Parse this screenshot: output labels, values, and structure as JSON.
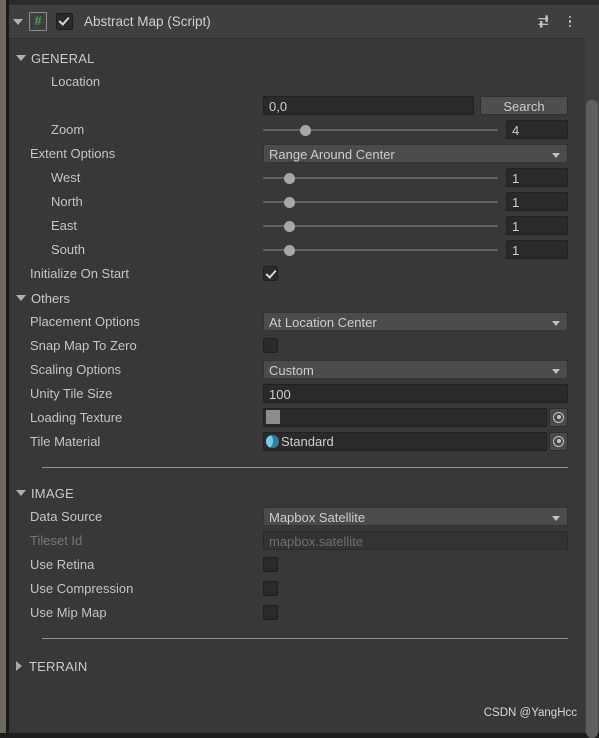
{
  "component": {
    "title": "Abstract Map (Script)",
    "enabled": true,
    "expanded": true,
    "script_icon": "csharp-script-icon",
    "preset_icon": "preset-sliders-icon",
    "menu_icon": "kebab-menu-icon"
  },
  "sections": {
    "general": {
      "label": "GENERAL",
      "expanded": true,
      "location": {
        "label": "Location",
        "value": "0,0",
        "placeholder": "",
        "search_label": "Search"
      },
      "zoom": {
        "label": "Zoom",
        "value": "4",
        "slider_percent": 18
      },
      "extent_options": {
        "label": "Extent Options",
        "value": "Range Around Center"
      },
      "extents": [
        {
          "label": "West",
          "value": "1",
          "slider_percent": 11
        },
        {
          "label": "North",
          "value": "1",
          "slider_percent": 11
        },
        {
          "label": "East",
          "value": "1",
          "slider_percent": 11
        },
        {
          "label": "South",
          "value": "1",
          "slider_percent": 11
        }
      ],
      "initialize_on_start": {
        "label": "Initialize On Start",
        "checked": true
      }
    },
    "others": {
      "label": "Others",
      "expanded": true,
      "placement_options": {
        "label": "Placement Options",
        "value": "At Location Center"
      },
      "snap_map_to_zero": {
        "label": "Snap Map To Zero",
        "checked": false
      },
      "scaling_options": {
        "label": "Scaling Options",
        "value": "Custom"
      },
      "unity_tile_size": {
        "label": "Unity Tile Size",
        "value": "100"
      },
      "loading_texture": {
        "label": "Loading Texture",
        "value": "",
        "icon": "texture-swatch-icon"
      },
      "tile_material": {
        "label": "Tile Material",
        "value": "Standard",
        "icon": "material-sphere-icon"
      }
    },
    "image": {
      "label": "IMAGE",
      "expanded": true,
      "data_source": {
        "label": "Data Source",
        "value": "Mapbox Satellite"
      },
      "tileset_id": {
        "label": "Tileset Id",
        "value": "mapbox.satellite",
        "disabled": true
      },
      "use_retina": {
        "label": "Use Retina",
        "checked": false
      },
      "use_compression": {
        "label": "Use Compression",
        "checked": false
      },
      "use_mip_map": {
        "label": "Use Mip Map",
        "checked": false
      }
    },
    "terrain": {
      "label": "TERRAIN",
      "expanded": false
    }
  },
  "watermark": "CSDN @YangHcc",
  "colors": {
    "panel_bg": "#383838",
    "header_bg": "#3f3f3f",
    "field_bg": "#2a2a2a",
    "dropdown_bg": "#4b4b4b",
    "text": "#c4c4c4",
    "script_green": "#4f9e5c",
    "material_blue": "#2f7f9e"
  }
}
